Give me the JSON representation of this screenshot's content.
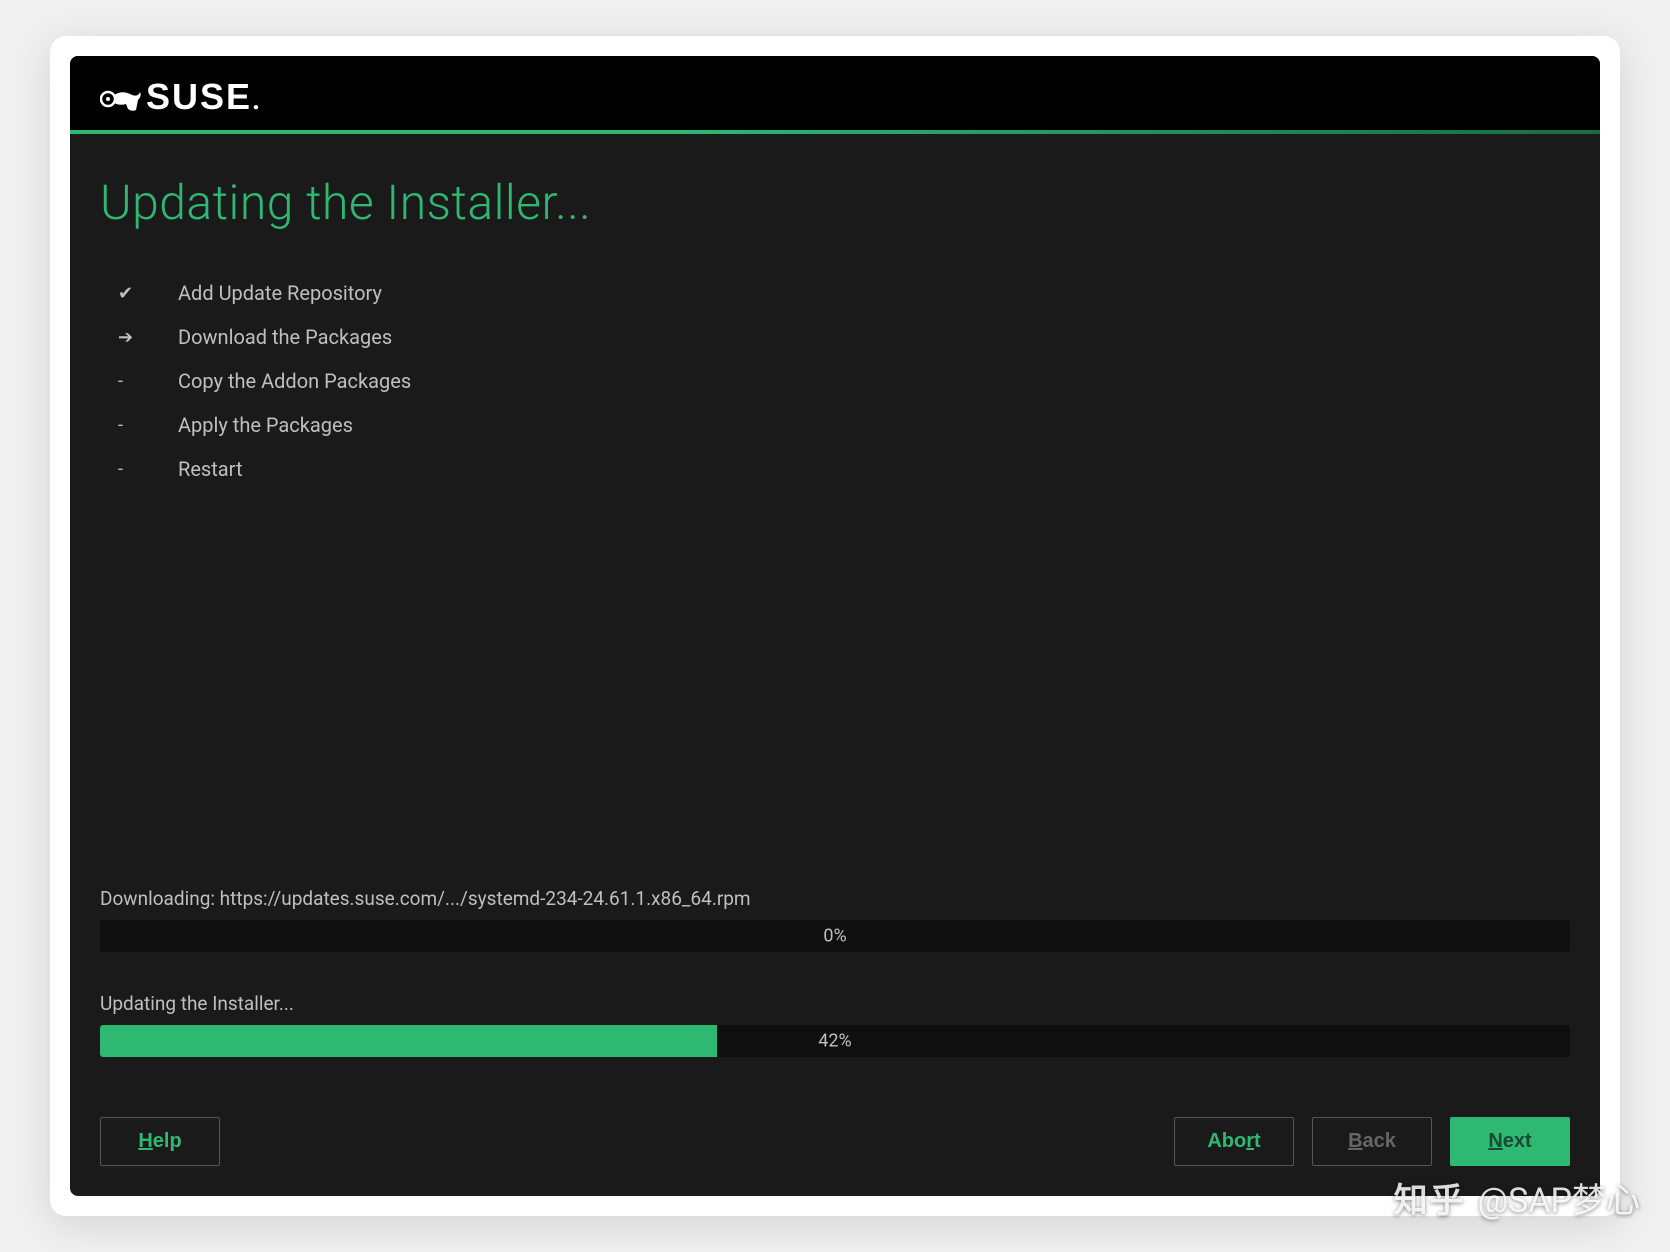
{
  "brand": "SUSE",
  "title": "Updating the Installer...",
  "steps": [
    {
      "icon": "✔",
      "label": "Add Update Repository"
    },
    {
      "icon": "➔",
      "label": "Download the Packages"
    },
    {
      "icon": "-",
      "label": "Copy the Addon Packages"
    },
    {
      "icon": "-",
      "label": "Apply the Packages"
    },
    {
      "icon": "-",
      "label": "Restart"
    }
  ],
  "progress1": {
    "label": "Downloading: https://updates.suse.com/.../systemd-234-24.61.1.x86_64.rpm",
    "percent": 0,
    "text": "0%"
  },
  "progress2": {
    "label": "Updating the Installer...",
    "percent": 42,
    "text": "42%"
  },
  "buttons": {
    "help": "Help",
    "abort": "Abort",
    "back": "Back",
    "next": "Next"
  },
  "watermark": {
    "brand": "知乎",
    "author": "@SAP梦心"
  }
}
